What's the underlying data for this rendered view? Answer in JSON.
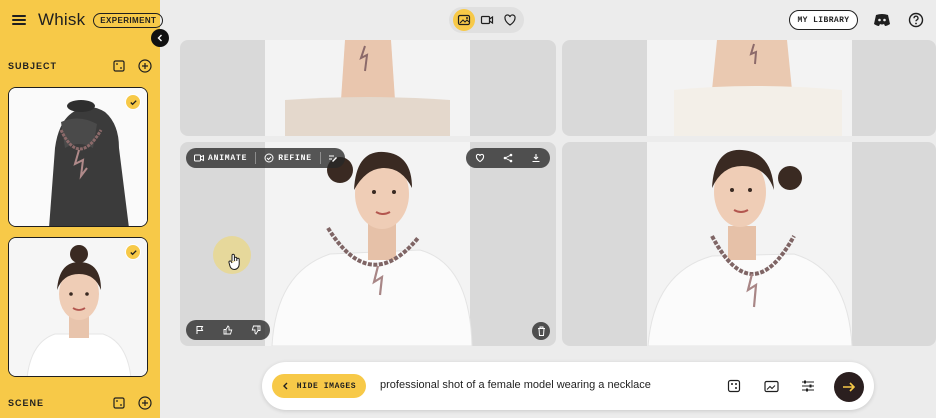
{
  "app": {
    "name": "Whisk",
    "badge": "EXPERIMENT"
  },
  "sidebar": {
    "subject_title": "SUBJECT",
    "scene_title": "SCENE",
    "subject_cards": [
      {
        "description": "necklace on black display bust",
        "selected": true
      },
      {
        "description": "portrait of a female model",
        "selected": true
      }
    ]
  },
  "topbar": {
    "modes": [
      "image-mode-icon",
      "video-mode-icon",
      "favorites-icon"
    ],
    "active_mode": "image-mode-icon",
    "library_label": "MY LIBRARY"
  },
  "tile_actions": {
    "animate_label": "ANIMATE",
    "refine_label": "REFINE"
  },
  "prompt": {
    "hide_images_label": "HIDE IMAGES",
    "text": "professional shot of a female model wearing a necklace"
  },
  "colors": {
    "accent": "#f7c948",
    "sidebar_bg": "#f7c948",
    "canvas_bg": "#ececec",
    "send_button": "#2b1f1f"
  }
}
